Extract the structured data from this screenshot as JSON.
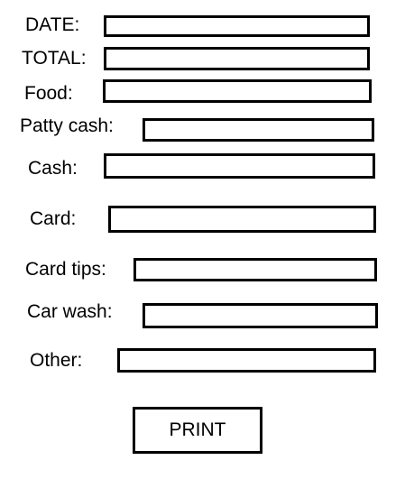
{
  "form": {
    "fields": [
      {
        "label": "DATE:",
        "value": ""
      },
      {
        "label": "TOTAL:",
        "value": ""
      },
      {
        "label": "Food:",
        "value": ""
      },
      {
        "label": "Patty cash:",
        "value": ""
      },
      {
        "label": "Cash:",
        "value": ""
      },
      {
        "label": "Card:",
        "value": ""
      },
      {
        "label": "Card tips:",
        "value": ""
      },
      {
        "label": "Car wash:",
        "value": ""
      },
      {
        "label": "Other:",
        "value": ""
      }
    ],
    "print_label": "PRINT"
  }
}
